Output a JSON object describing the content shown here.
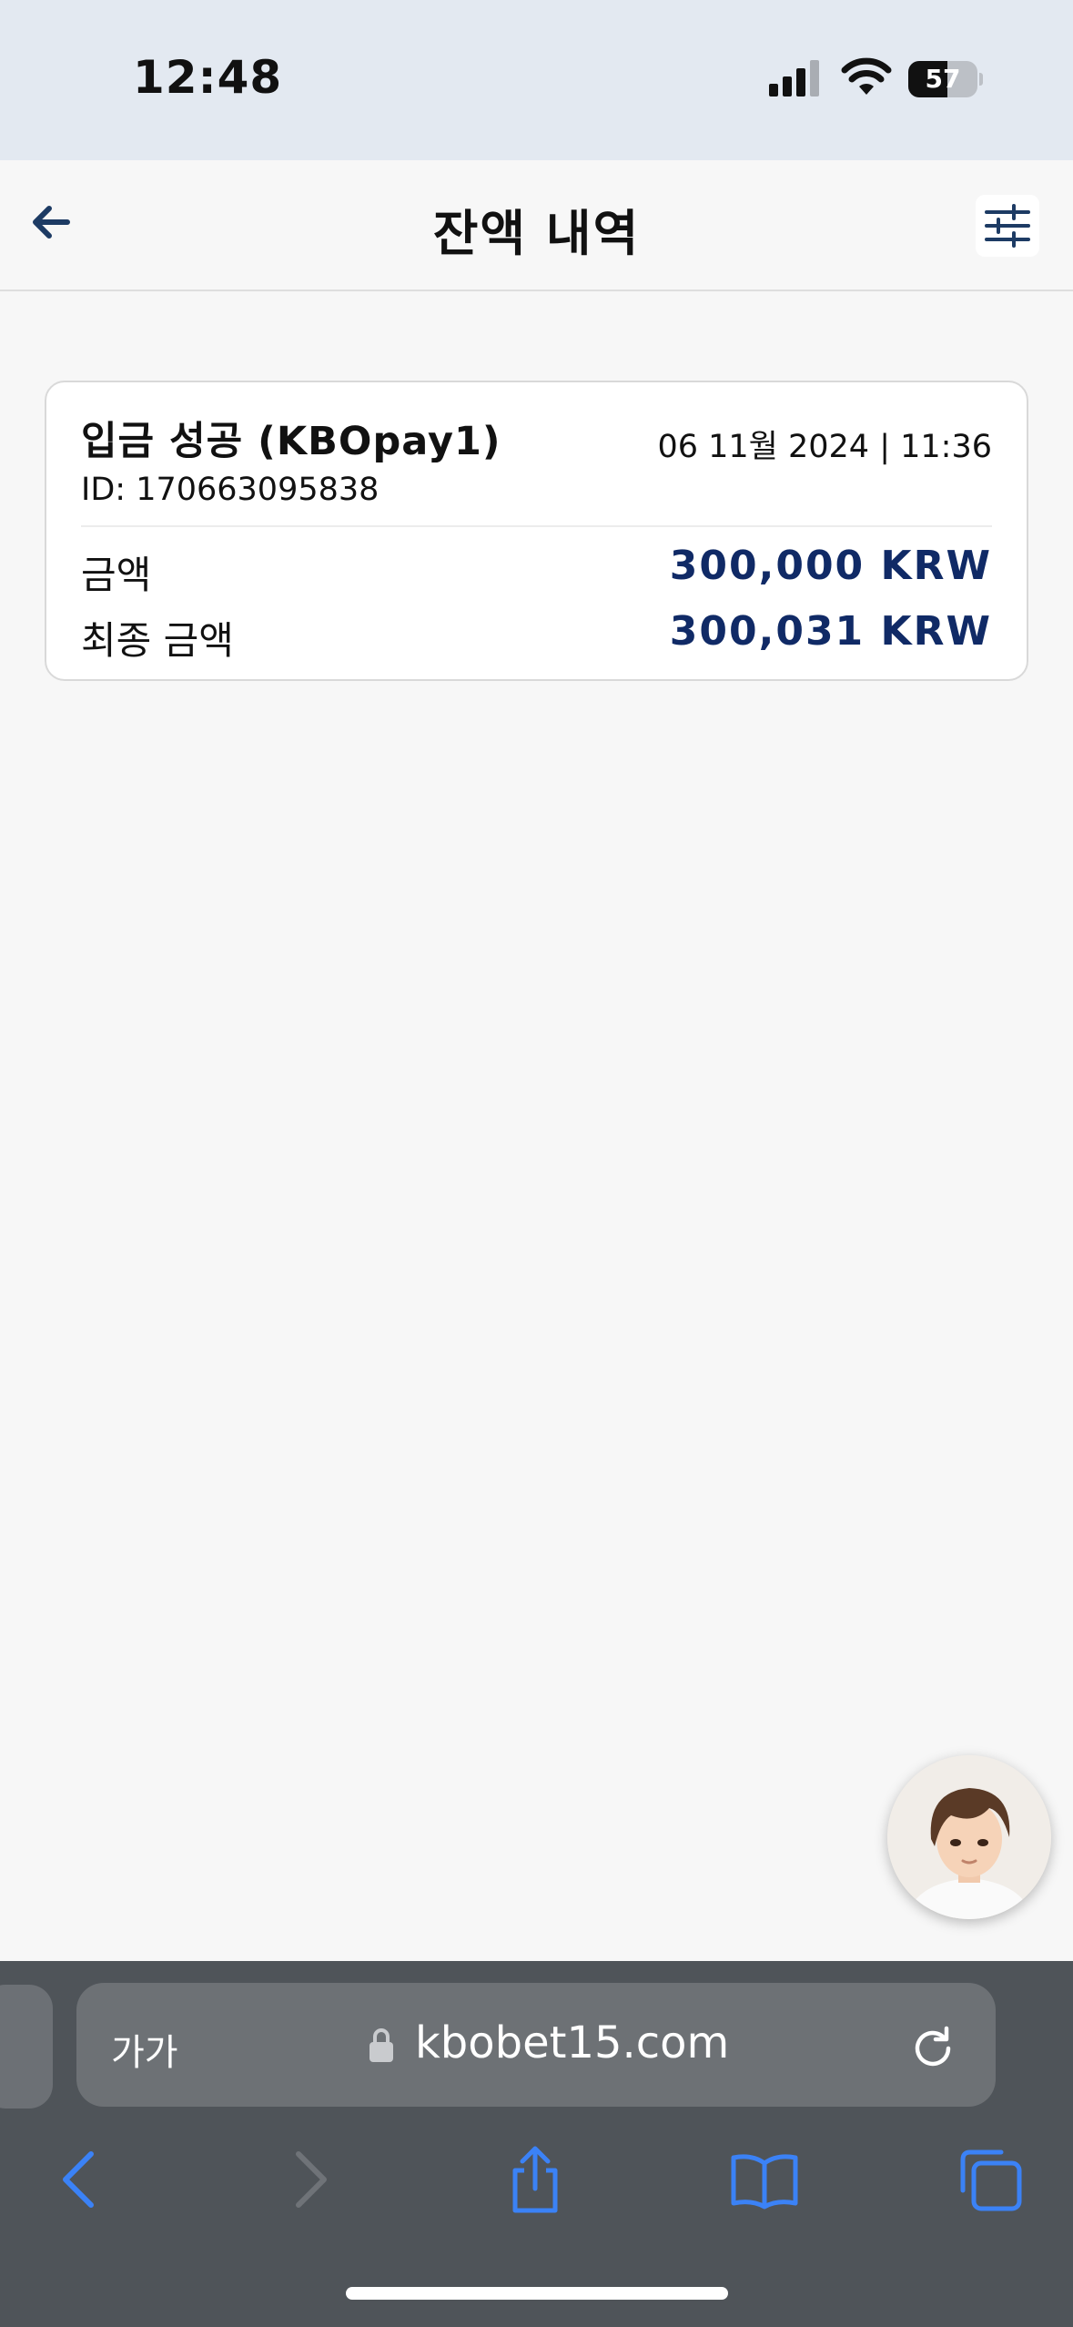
{
  "status_bar": {
    "time": "12:48",
    "battery_level": "57",
    "battery_fraction": 0.57
  },
  "header": {
    "title": "잔액 내역",
    "back_icon": "arrow-left-icon",
    "filter_icon": "sliders-icon"
  },
  "transaction": {
    "title": "입금 성공 (KBOpay1)",
    "datetime": "06 11월 2024 | 11:36",
    "id_label": "ID: ",
    "id_value": "170663095838",
    "rows": [
      {
        "label": "금액",
        "value": "300,000 KRW"
      },
      {
        "label": "최종 금액",
        "value": "300,031 KRW"
      }
    ]
  },
  "chat_widget": {
    "icon": "support-avatar"
  },
  "browser": {
    "text_size_label": "가가",
    "url": "kbobet15.com",
    "toolbar_icons": [
      "back-icon",
      "forward-icon",
      "share-icon",
      "bookmarks-icon",
      "tabs-icon"
    ]
  },
  "colors": {
    "amount": "#102a66",
    "status_bar_bg": "#e3e9f1",
    "page_bg": "#f7f7f7",
    "browser_bg": "#4f5459",
    "browser_accent": "#3b82f6"
  }
}
